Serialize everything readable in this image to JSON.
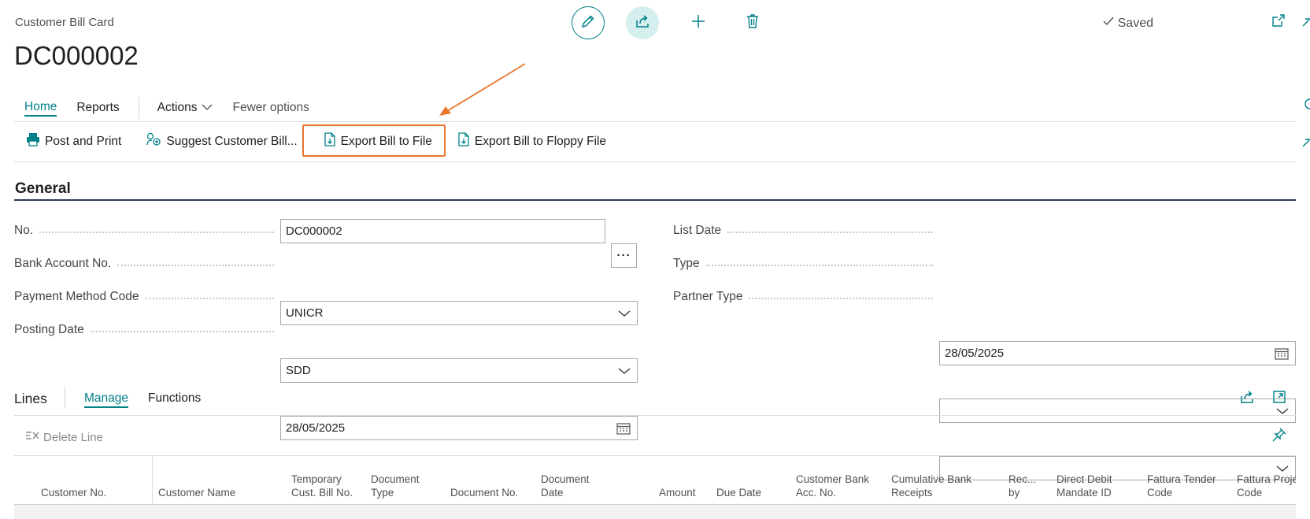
{
  "page": {
    "caption": "Customer Bill Card",
    "title": "DC000002",
    "status": "Saved"
  },
  "header_icons": [
    "edit-icon",
    "share-icon",
    "add-icon",
    "delete-icon",
    "open-new-window-icon",
    "collapse-icon"
  ],
  "tabs": {
    "home": "Home",
    "reports": "Reports",
    "actions": "Actions",
    "fewer": "Fewer options"
  },
  "toolbar": {
    "post_print": "Post and Print",
    "suggest": "Suggest Customer Bill...",
    "export_file": "Export Bill to File",
    "export_floppy": "Export Bill to Floppy File"
  },
  "general": {
    "title": "General",
    "no_label": "No.",
    "no_value": "DC000002",
    "bank_label": "Bank Account No.",
    "bank_value": "UNICR",
    "payment_label": "Payment Method Code",
    "payment_value": "SDD",
    "posting_label": "Posting Date",
    "posting_value": "28/05/2025",
    "list_date_label": "List Date",
    "list_date_value": "28/05/2025",
    "type_label": "Type",
    "type_value": "",
    "partner_label": "Partner Type",
    "partner_value": ""
  },
  "lines": {
    "title": "Lines",
    "manage": "Manage",
    "functions": "Functions",
    "delete_line": "Delete Line",
    "columns": {
      "customer_no": "Customer No.",
      "customer_name": "Customer Name",
      "temp_bill_1": "Temporary",
      "temp_bill_2": "Cust. Bill No.",
      "doc_type_1": "Document",
      "doc_type_2": "Type",
      "doc_no": "Document No.",
      "doc_date_1": "Document",
      "doc_date_2": "Date",
      "amount": "Amount",
      "due_date": "Due Date",
      "cust_bank_1": "Customer Bank",
      "cust_bank_2": "Acc. No.",
      "cum_bank_1": "Cumulative Bank",
      "cum_bank_2": "Receipts",
      "rec_by_1": "Rec...",
      "rec_by_2": "by",
      "dd_mandate_1": "Direct Debit",
      "dd_mandate_2": "Mandate ID",
      "fattura_tender_1": "Fattura Tender",
      "fattura_tender_2": "Code",
      "fattura_proj_1": "Fattura Proje",
      "fattura_proj_2": "Code"
    }
  },
  "colors": {
    "accent": "#00818a",
    "highlight": "#e8762d",
    "section_rule": "#2b3a55"
  }
}
